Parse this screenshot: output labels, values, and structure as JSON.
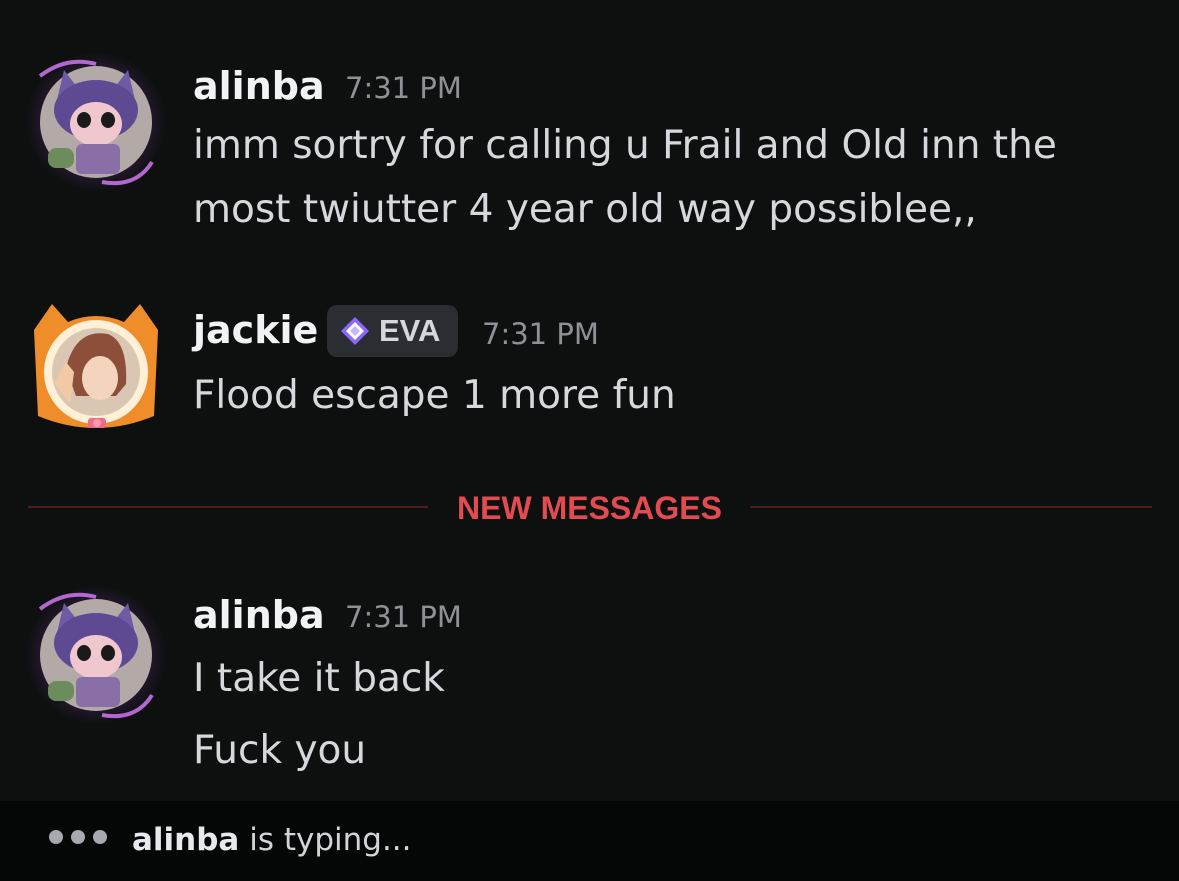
{
  "messages": [
    {
      "username": "alinba",
      "time": "7:31 PM",
      "lines": [
        "imm sortry for calling u Frail and Old inn the",
        "most twiutter 4 year old way possiblee,,"
      ]
    },
    {
      "username": "jackie",
      "tag": "EVA",
      "time": "7:31 PM",
      "lines": [
        "Flood escape 1 more fun"
      ]
    },
    {
      "username": "alinba",
      "time": "7:31 PM",
      "lines": [
        "I take it back",
        "Fuck you"
      ]
    }
  ],
  "divider": {
    "label": "NEW MESSAGES",
    "color": "#e34b50"
  },
  "typing": {
    "name": "alinba",
    "suffix": " is typing..."
  },
  "colors": {
    "background": "#0d100f",
    "username": "#f2f3f5",
    "timestamp": "#8e9297",
    "message_text": "#d6d8dc",
    "alinba_glow": "#c66bff",
    "jackie_frame": "#ef8d2a"
  },
  "icons": {
    "tag_icon": "purple-diamond-icon",
    "typing_indicator": "three-dots-icon"
  }
}
